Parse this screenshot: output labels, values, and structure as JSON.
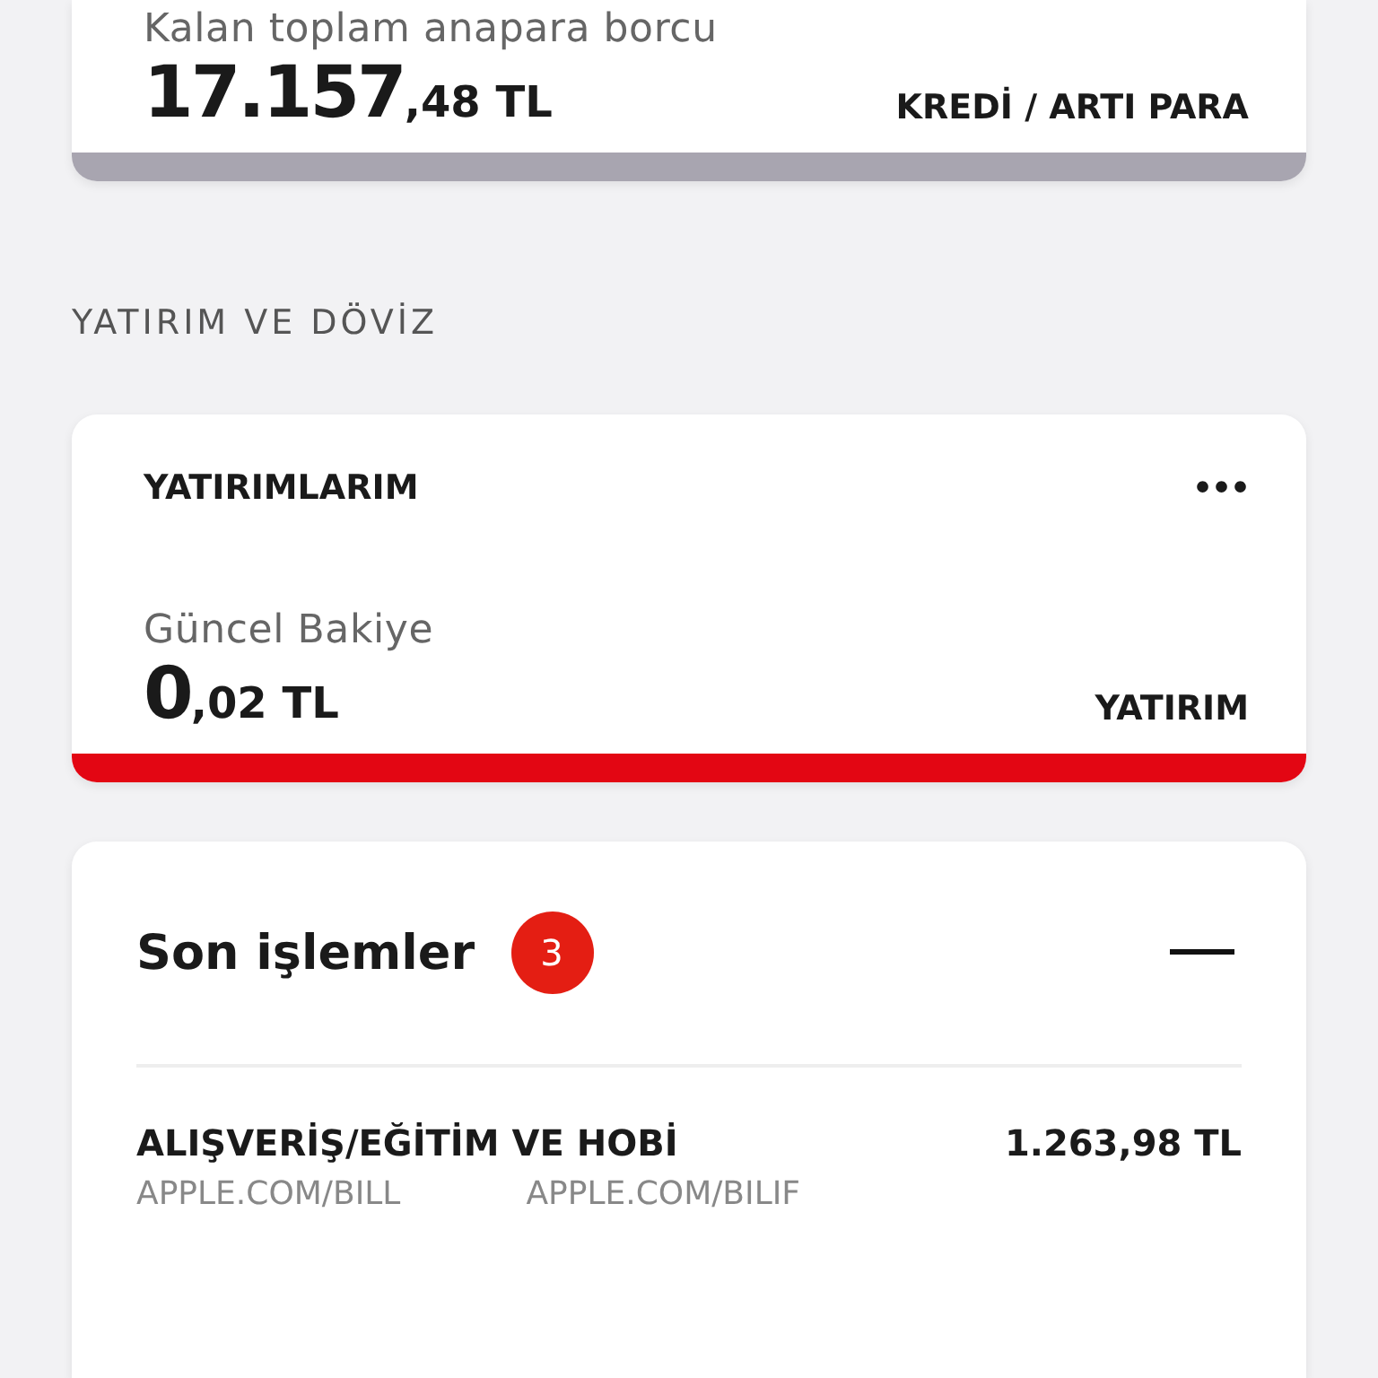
{
  "accounts": [
    {
      "label": "Kalan toplam anapara borcu",
      "amount_main": "17.157",
      "amount_fraction": ",48 TL",
      "action": "KREDİ / ARTI PARA",
      "color": "#a8a5b0"
    }
  ],
  "section_title": "YATIRIM VE DÖVİZ",
  "investment": {
    "title": "YATIRIMLARIM",
    "menu": "•••",
    "label": "Güncel Bakiye",
    "amount_main": "0",
    "amount_fraction": ",02 TL",
    "action": "YATIRIM",
    "color": "#e30613"
  },
  "transactions": {
    "title": "Son işlemler",
    "badge": "3",
    "expanded": true,
    "rows": [
      {
        "category": "ALIŞVERİŞ/EĞİTİM VE HOBİ",
        "amount": "1.263,98 TL",
        "merchant": "APPLE.COM/BILL",
        "detail": "APPLE.COM/BILIF"
      }
    ]
  }
}
